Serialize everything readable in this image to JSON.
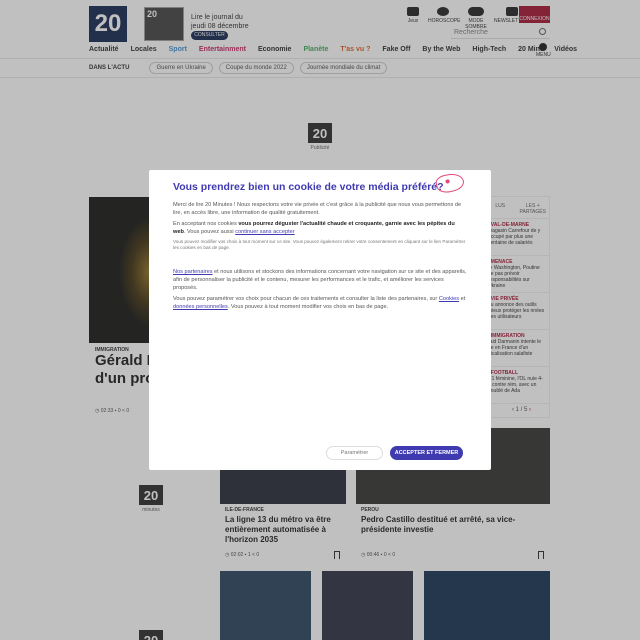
{
  "header": {
    "logo_text": "20",
    "logo_sub": "minutes",
    "journal_number": "20",
    "journal_line1": "Lire le journal du",
    "journal_line2": "jeudi 08 décembre",
    "consult_label": "CONSULTER",
    "tools": [
      {
        "label": "Jeux",
        "icon": "puzzle-icon"
      },
      {
        "label": "HOROSCOPE",
        "icon": "horoscope-icon"
      },
      {
        "label": "MODE SOMBRE",
        "icon": "dark-mode-toggle-icon"
      },
      {
        "label": "NEWSLETTERS",
        "icon": "mail-icon"
      }
    ],
    "connect_label": "CONNEXION",
    "search_placeholder": "Recherche",
    "nav": [
      "Actualité",
      "Locales",
      "Sport",
      "Entertainment",
      "Economie",
      "Planète",
      "T'as vu ?",
      "Fake Off",
      "By the Web",
      "High-Tech",
      "20 Mint",
      "Vidéos"
    ],
    "nav_colors": [
      "#222222",
      "#222222",
      "#3a8bd1",
      "#c2185b",
      "#222222",
      "#3aa35a",
      "#e0561a",
      "#222222",
      "#222222",
      "#222222",
      "#222222",
      "#222222"
    ],
    "menu_label": "MENU"
  },
  "subnav": {
    "label": "DANS L'ACTU",
    "pills": [
      "Guerre en Ukraine",
      "Coupe du monde 2022",
      "Journée mondiale du climat"
    ]
  },
  "ads": {
    "logo_text": "20",
    "sub": "minutes",
    "ad_label": "Publicité"
  },
  "hero": {
    "tag": "IMMIGRATION",
    "title_line1": "Gérald D",
    "title_line2": "d'un pro",
    "time": "02:33",
    "comments": "0",
    "shares": "0"
  },
  "sidebar": {
    "tabs": [
      "LUS",
      "LES + PARTAGÉS"
    ],
    "items": [
      {
        "tag": "| VAL-DE-MARNE",
        "text": "magasin Carrefour de y occupé par plus une centaine de salariés"
      },
      {
        "tag": "| MENACE",
        "text": "re Washington, Poutine ne pas prévoir responsabilités sur Ukraine"
      },
      {
        "tag": "| VIE PRIVÉE",
        "text": "du annonce des outils mieux protéger les nnées des utilisateurs"
      },
      {
        "tag": "| IMMIGRATION",
        "text": "raid Darmanin intente le ue en France d'un dicalisation salafiste"
      },
      {
        "tag": "| FOOTBALL",
        "text": "C1 féminine, l'OL nuie 4-0 contre rém, avec un doublé de Ada"
      }
    ],
    "pager": "1 / 5"
  },
  "cards": [
    {
      "tag": "ILE-DE-FRANCE",
      "title_l1": "La ligne 13 du métro va être",
      "title_l2": "entièrement automatisée à",
      "title_l3": "l'horizon 2035",
      "time": "02:02",
      "comments": "1",
      "shares": "0"
    },
    {
      "tag": "PEROU",
      "title_l1": "Pedro Castillo destitué et arrêté, sa vice-",
      "title_l2": "présidente investie",
      "time": "00:46",
      "comments": "0",
      "shares": "0"
    }
  ],
  "cookie_modal": {
    "title": "Vous prendrez bien un cookie de votre média préféré?",
    "p1": "Merci de lire 20 Minutes ! Nous respectons votre vie privée et c'est grâce à la publicité que nous vous permettons de lire, en accès libre, une information de qualité gratuitement.",
    "p2_pre": "En acceptant nos cookies ",
    "p2_bold": "vous pourrez déguster l'actualité chaude et croquante, garnie avec les pépites du web",
    "p2_post": ". Vous pouvez aussi ",
    "p2_link": "continuer sans accepter",
    "fine": "Vous pouvez modifier vos choix à tout moment sur ce site. Vous pouvez également retirer votre consentement en cliquant sur le lien Paramétrer les cookies en bas de page.",
    "p3_link": "Nos partenaires",
    "p3": " et nous utilisons et stockons des informations concernant votre navigation sur ce site et des appareils, afin de personnaliser la publicité et le contenu, mesurer les performances et le trafic, et améliorer les services proposés.",
    "p4_pre": "Vous pouvez paramétrer vos choix pour chacun de ces traitements et consulter la liste des partenaires, sur ",
    "p4_link1": "Cookies",
    "p4_mid": " et ",
    "p4_link2": "données personnelles",
    "p4_post": ". Vous pouvez à tout moment modifier vos choix en bas de page.",
    "refuse_label": "Paramétrer",
    "accept_label": "ACCEPTER ET FERMER"
  },
  "colors": {
    "brand": "#0a1e4a",
    "accent_purple": "#3f3ab0",
    "connect_red": "#a10a2a",
    "overlay": "rgba(80,80,80,0.36)"
  }
}
